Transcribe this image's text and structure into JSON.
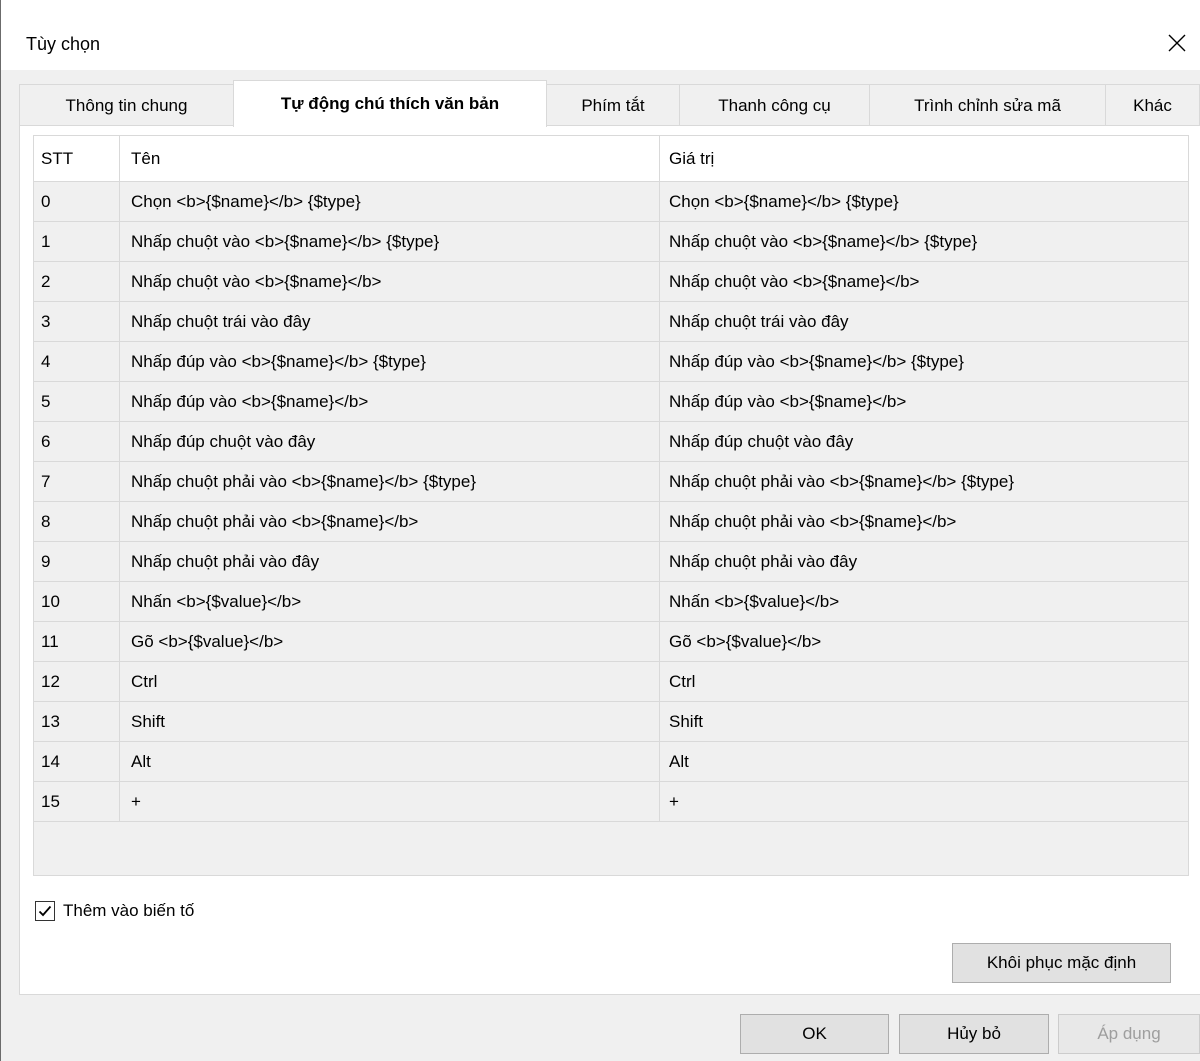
{
  "window": {
    "title": "Tùy chọn"
  },
  "tabs": [
    {
      "label": "Thông tin chung"
    },
    {
      "label": "Tự động chú thích văn bản"
    },
    {
      "label": "Phím tắt"
    },
    {
      "label": "Thanh công cụ"
    },
    {
      "label": "Trình chỉnh sửa mã"
    },
    {
      "label": "Khác"
    }
  ],
  "active_tab": "Tự động chú thích văn bản",
  "table": {
    "columns": [
      "STT",
      "Tên",
      "Giá trị"
    ],
    "rows": [
      [
        "0",
        "Chọn <b>{$name}</b> {$type}",
        "Chọn <b>{$name}</b> {$type}"
      ],
      [
        "1",
        "Nhấp chuột vào <b>{$name}</b> {$type}",
        "Nhấp chuột vào <b>{$name}</b> {$type}"
      ],
      [
        "2",
        "Nhấp chuột vào <b>{$name}</b>",
        "Nhấp chuột vào <b>{$name}</b>"
      ],
      [
        "3",
        "Nhấp chuột trái vào đây",
        "Nhấp chuột trái vào đây"
      ],
      [
        "4",
        "Nhấp đúp vào <b>{$name}</b> {$type}",
        "Nhấp đúp vào <b>{$name}</b> {$type}"
      ],
      [
        "5",
        "Nhấp đúp vào <b>{$name}</b>",
        "Nhấp đúp vào <b>{$name}</b>"
      ],
      [
        "6",
        "Nhấp đúp chuột vào đây",
        "Nhấp đúp chuột vào đây"
      ],
      [
        "7",
        "Nhấp chuột phải vào <b>{$name}</b> {$type}",
        "Nhấp chuột phải vào <b>{$name}</b> {$type}"
      ],
      [
        "8",
        "Nhấp chuột phải vào <b>{$name}</b>",
        "Nhấp chuột phải vào <b>{$name}</b>"
      ],
      [
        "9",
        "Nhấp chuột phải vào đây",
        "Nhấp chuột phải vào đây"
      ],
      [
        "10",
        "Nhấn <b>{$value}</b>",
        "Nhấn <b>{$value}</b>"
      ],
      [
        "11",
        "Gõ <b>{$value}</b>",
        "Gõ <b>{$value}</b>"
      ],
      [
        "12",
        "Ctrl",
        "Ctrl"
      ],
      [
        "13",
        "Shift",
        "Shift"
      ],
      [
        "14",
        "Alt",
        "Alt"
      ],
      [
        "15",
        "+",
        "+"
      ]
    ]
  },
  "checkbox": {
    "label": "Thêm vào biến tố",
    "checked": true
  },
  "buttons": {
    "restore": "Khôi phục mặc định",
    "ok": "OK",
    "cancel": "Hủy bỏ",
    "apply": "Áp dụng",
    "apply_disabled": true
  },
  "icons": {
    "close": "close-icon",
    "check": "check-icon"
  }
}
